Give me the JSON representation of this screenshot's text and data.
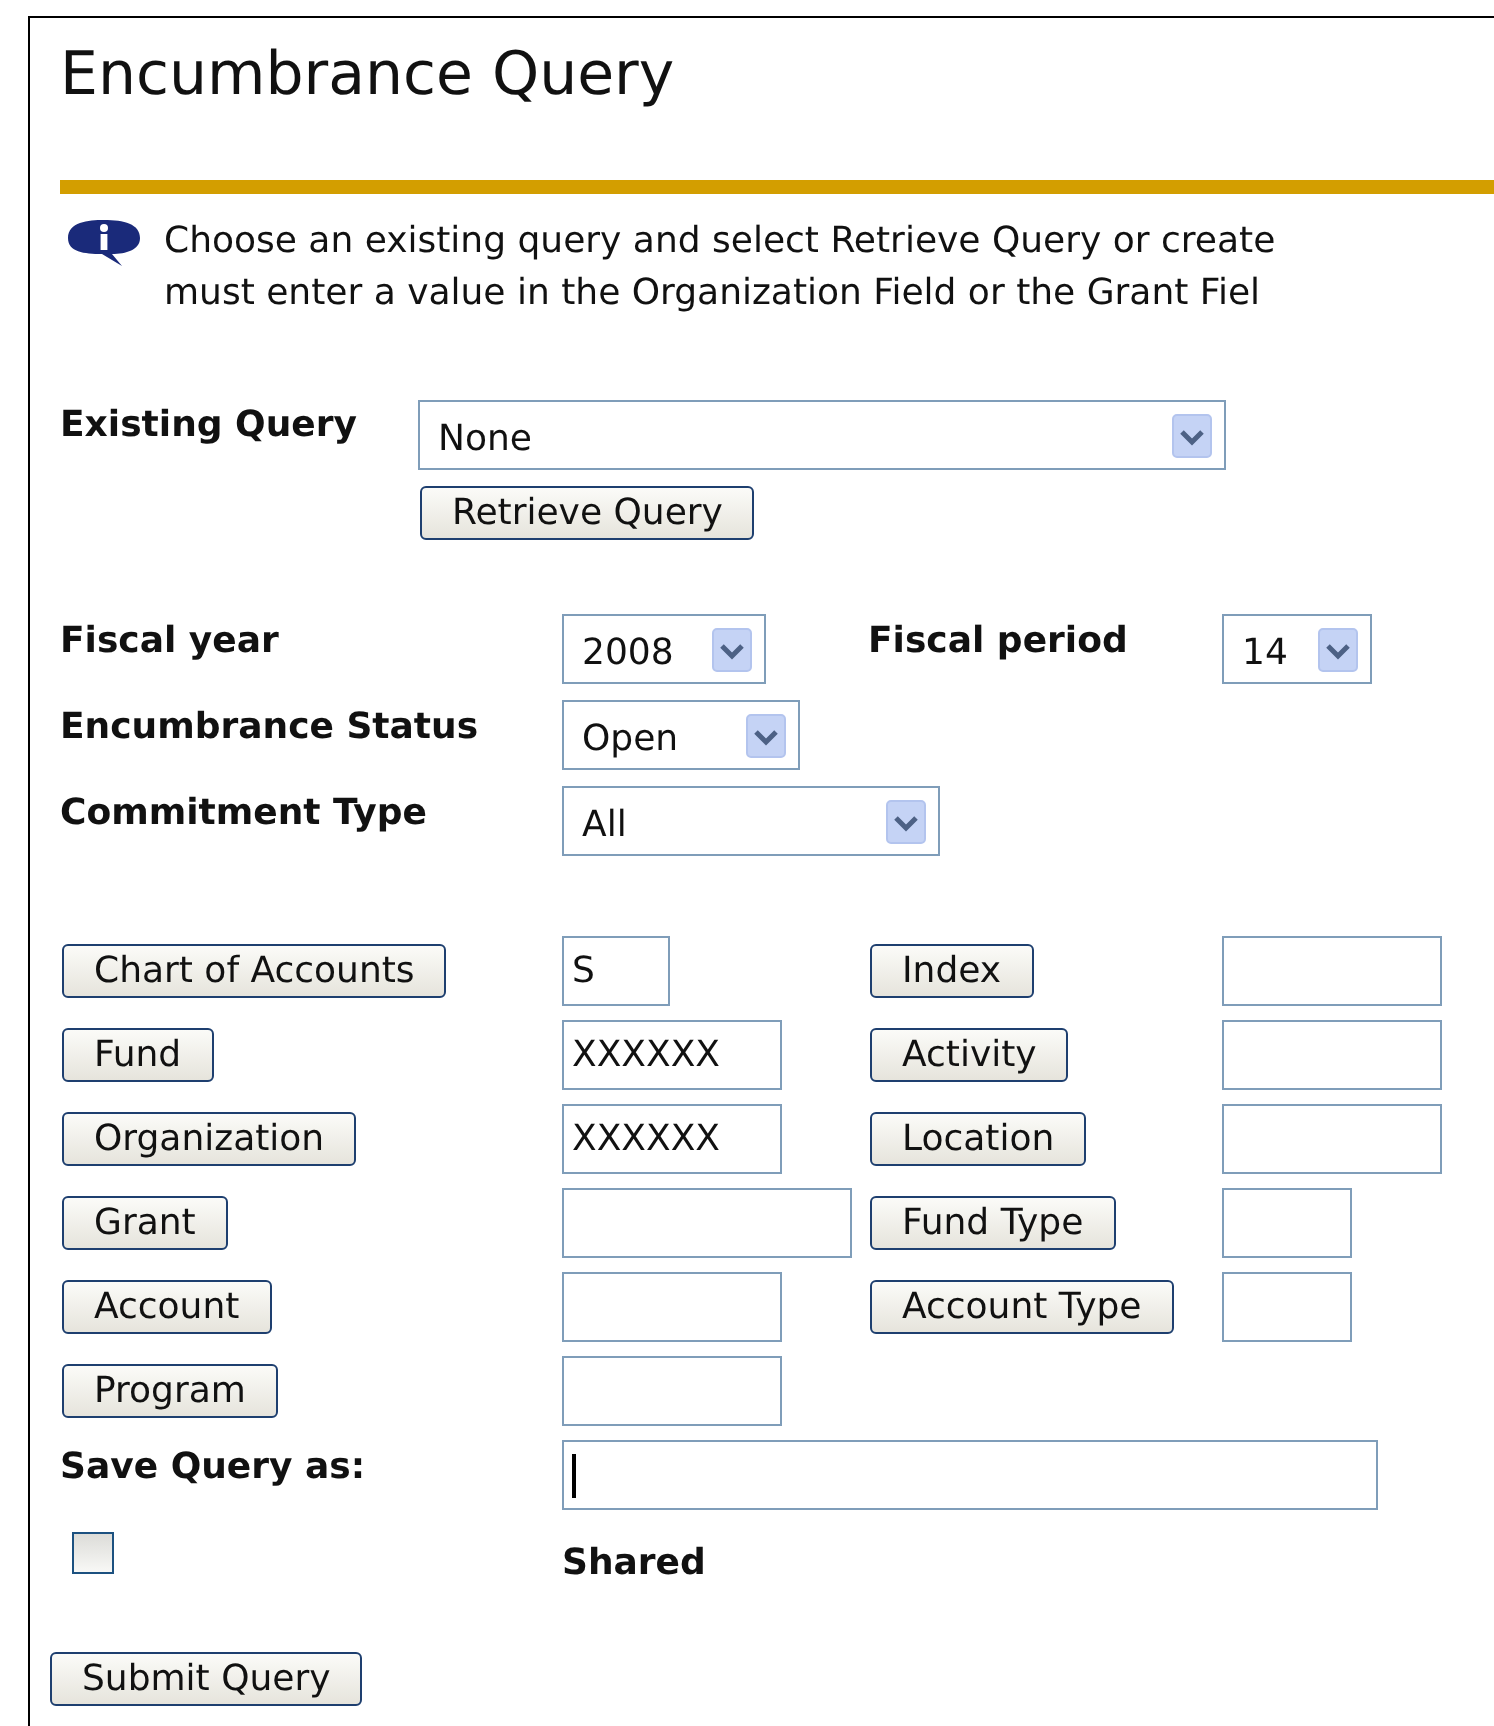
{
  "title": "Encumbrance Query",
  "info": {
    "lines": [
      "Choose an existing query and select Retrieve Query or create",
      "must enter a value in the Organization Field or the Grant Fiel"
    ]
  },
  "existing_query": {
    "label": "Existing Query",
    "value": "None",
    "button": "Retrieve Query"
  },
  "period_fields": [
    {
      "label": "Fiscal year",
      "value": "2008"
    },
    {
      "label": "Fiscal period",
      "value": "14"
    },
    {
      "label": "Encumbrance Status",
      "value": "Open"
    },
    {
      "label": "Commitment Type",
      "value": "All"
    }
  ],
  "lookup_rows": [
    {
      "left": {
        "button": "Chart of Accounts",
        "value": "S"
      },
      "right": {
        "button": "Index"
      }
    },
    {
      "left": {
        "button": "Fund",
        "value": "XXXXXX"
      },
      "right": {
        "button": "Activity"
      }
    },
    {
      "left": {
        "button": "Organization",
        "value": "XXXXXX"
      },
      "right": {
        "button": "Location"
      }
    },
    {
      "left": {
        "button": "Grant"
      },
      "right": {
        "button": "Fund Type"
      }
    },
    {
      "left": {
        "button": "Account"
      },
      "right": {
        "button": "Account Type"
      }
    },
    {
      "left": {
        "button": "Program"
      }
    }
  ],
  "save_query": {
    "label": "Save Query as:",
    "focused": true
  },
  "shared": {
    "label": "Shared",
    "checked": false
  },
  "submit_button": "Submit Query"
}
